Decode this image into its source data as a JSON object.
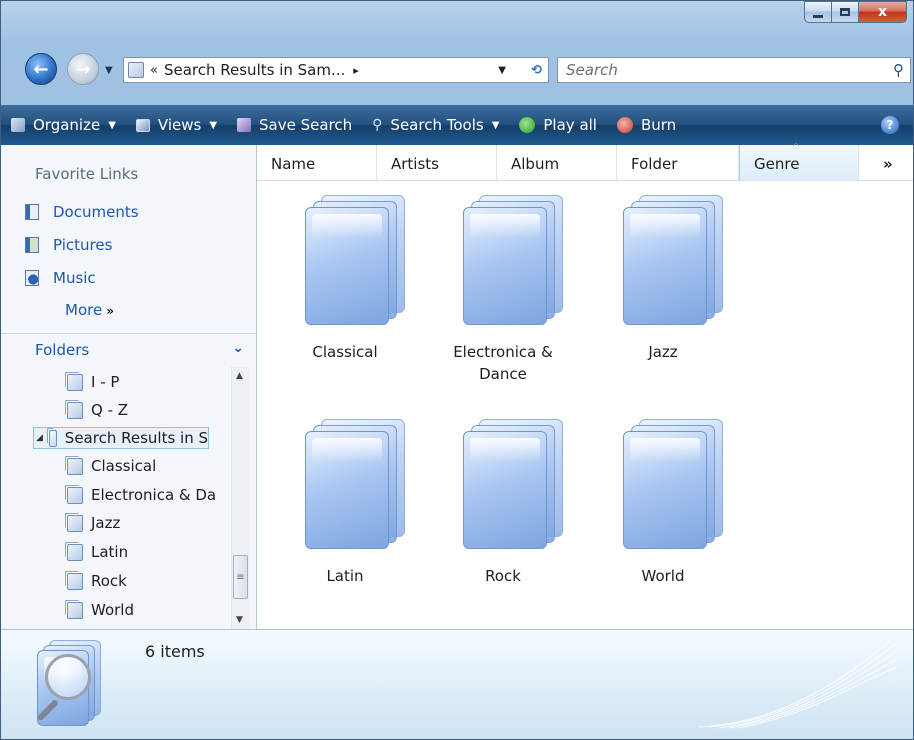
{
  "window": {
    "caption_buttons": {
      "minimize": "minimize",
      "maximize": "maximize",
      "close": "x"
    }
  },
  "navigation": {
    "back": "back",
    "forward": "forward",
    "address": {
      "chevron": "«",
      "path": "Search Results in Sam...",
      "arrow": "▸"
    },
    "search_placeholder": "Search"
  },
  "toolbar": {
    "items": [
      {
        "label": "Organize",
        "icon": "organize-icon",
        "has_dropdown": true
      },
      {
        "label": "Views",
        "icon": "views-icon",
        "has_dropdown": true
      },
      {
        "label": "Save Search",
        "icon": "save-icon",
        "has_dropdown": false
      },
      {
        "label": "Search Tools",
        "icon": "search-tools-icon",
        "has_dropdown": true
      },
      {
        "label": "Play all",
        "icon": "play-icon",
        "has_dropdown": false
      },
      {
        "label": "Burn",
        "icon": "burn-icon",
        "has_dropdown": false
      }
    ],
    "help": "?"
  },
  "sidebar": {
    "favorite_links_title": "Favorite Links",
    "favorites": [
      {
        "label": "Documents",
        "icon": "documents-icon"
      },
      {
        "label": "Pictures",
        "icon": "pictures-icon"
      },
      {
        "label": "Music",
        "icon": "music-icon"
      }
    ],
    "more": "More",
    "more_glyph": "»",
    "folders_title": "Folders",
    "folders_chevron": "⌄",
    "tree": [
      {
        "label": "I - P"
      },
      {
        "label": "Q - Z"
      },
      {
        "label": "Search Results in S",
        "selected": true,
        "expander": "◢"
      },
      {
        "label": "Classical"
      },
      {
        "label": "Electronica & Da"
      },
      {
        "label": "Jazz"
      },
      {
        "label": "Latin"
      },
      {
        "label": "Rock"
      },
      {
        "label": "World"
      }
    ],
    "scrollbar": {
      "up": "▲",
      "down": "▼",
      "grip": "≡"
    }
  },
  "columns": [
    {
      "label": "Name"
    },
    {
      "label": "Artists"
    },
    {
      "label": "Album"
    },
    {
      "label": "Folder"
    },
    {
      "label": "Genre",
      "sorted": true
    },
    {
      "label": "»"
    }
  ],
  "items": [
    {
      "label": "Classical"
    },
    {
      "label": "Electronica & Dance"
    },
    {
      "label": "Jazz"
    },
    {
      "label": "Latin"
    },
    {
      "label": "Rock"
    },
    {
      "label": "World"
    }
  ],
  "details": {
    "count_text": "6 items"
  },
  "colors": {
    "command_bar": "#22507f",
    "link_blue": "#1e56b6",
    "folder_blue": "#a9c6f1"
  }
}
